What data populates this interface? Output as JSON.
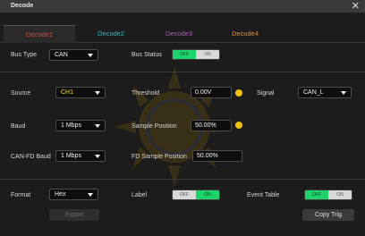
{
  "window": {
    "title": "Decode",
    "close_glyph": "✕"
  },
  "tabs": [
    {
      "label": "Decode1",
      "active": true
    },
    {
      "label": "Decode2",
      "active": false
    },
    {
      "label": "Decode3",
      "active": false
    },
    {
      "label": "Decode4",
      "active": false
    }
  ],
  "bus": {
    "type_label": "Bus Type",
    "type_value": "CAN",
    "status_label": "Bus Status",
    "status_off": "OFF",
    "status_on": "ON"
  },
  "source": {
    "label": "Source",
    "value": "CH1",
    "threshold_label": "Threshold",
    "threshold_value": "0.00V",
    "signal_label": "Signal",
    "signal_value": "CAN_L"
  },
  "baud": {
    "label": "Baud",
    "value": "1 Mbps",
    "sample_label": "Sample Position",
    "sample_value": "50.00%"
  },
  "canfd": {
    "label": "CAN-FD Baud",
    "value": "1 Mbps",
    "sample_label": "FD Sample Position",
    "sample_value": "50.00%"
  },
  "format": {
    "label": "Format",
    "value": "Hex",
    "label_label": "Label",
    "label_off": "OFF",
    "label_on": "ON",
    "event_label": "Event Table",
    "event_off": "OFF",
    "event_on": "ON"
  },
  "actions": {
    "export": "Export",
    "copy_trig": "Copy Trig"
  },
  "colors": {
    "decode1": "#ff3d2e",
    "decode2": "#13c6c6",
    "decode3": "#c64bd8",
    "decode4": "#ff8a1a",
    "toggle_on": "#1dd36a",
    "toggle_off": "#d8d8d8",
    "hint": "#f1c20d"
  }
}
